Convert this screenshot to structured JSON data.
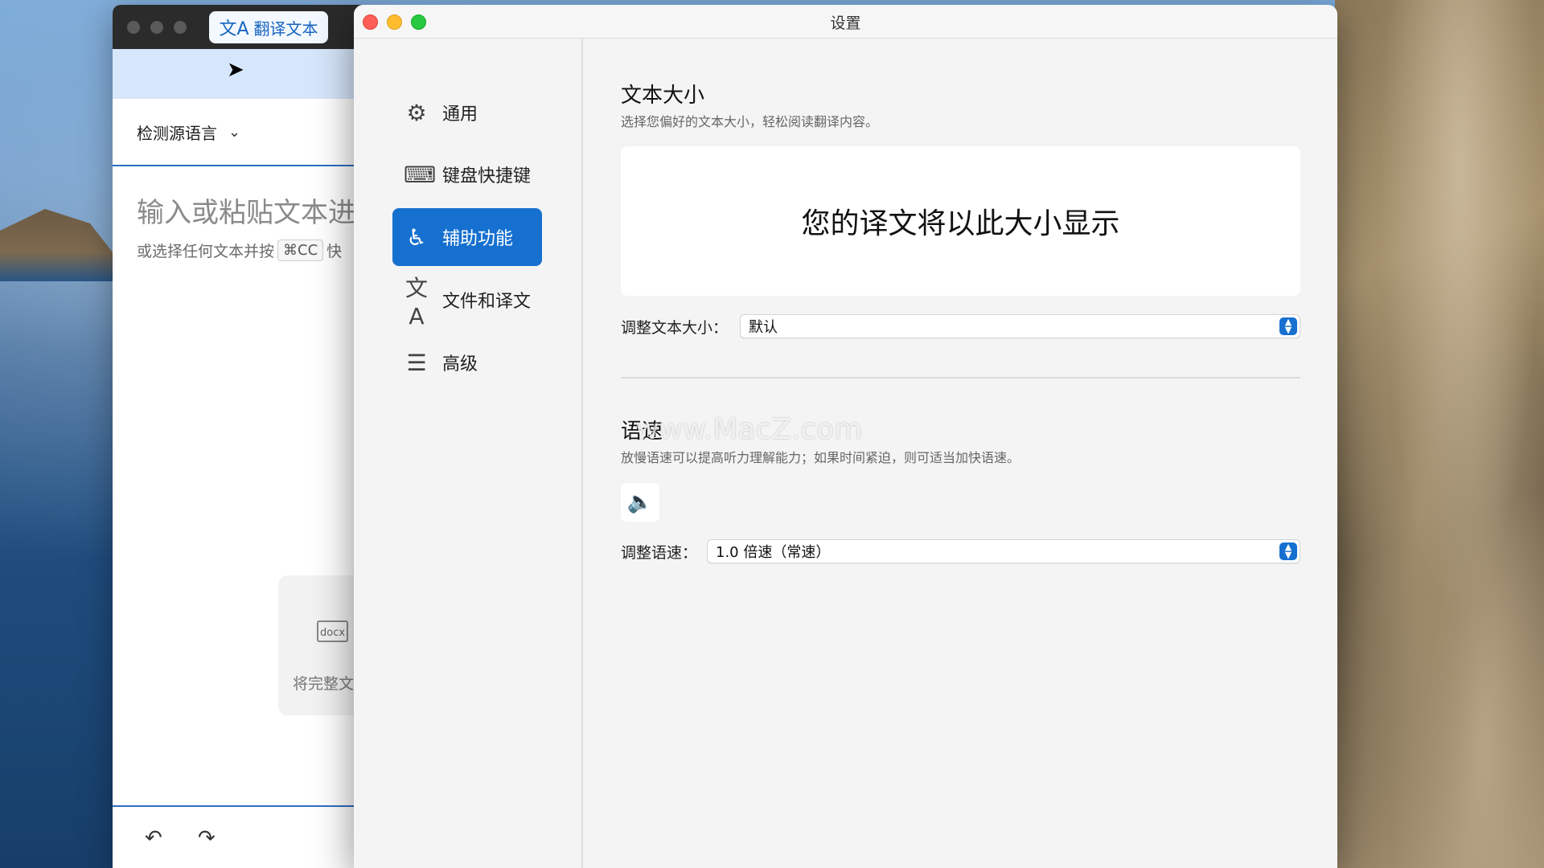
{
  "background_window": {
    "tab_label": "翻译文本",
    "source_language": "检测源语言",
    "input_placeholder": "输入或粘贴文本进",
    "hint_prefix": "或选择任何文本并按",
    "hint_shortcut": "⌘CC",
    "hint_suffix": "快",
    "drop_file_label": "docx",
    "drop_text": "将完整文"
  },
  "settings": {
    "window_title": "设置",
    "sidebar": [
      {
        "label": "通用",
        "icon": "gear-icon"
      },
      {
        "label": "键盘快捷键",
        "icon": "keyboard-icon"
      },
      {
        "label": "辅助功能",
        "icon": "accessibility-icon",
        "active": true
      },
      {
        "label": "文件和译文",
        "icon": "translate-icon"
      },
      {
        "label": "高级",
        "icon": "sliders-icon"
      }
    ],
    "text_size": {
      "title": "文本大小",
      "description": "选择您偏好的文本大小，轻松阅读翻译内容。",
      "preview": "您的译文将以此大小显示",
      "adjust_label": "调整文本大小：",
      "adjust_value": "默认"
    },
    "speech_rate": {
      "title": "语速",
      "description": "放慢语速可以提高听力理解能力；如果时间紧迫，则可适当加快语速。",
      "adjust_label": "调整语速：",
      "adjust_value": "1.0 倍速（常速）"
    }
  },
  "watermark": "www.MacZ.com",
  "colors": {
    "accent": "#1670d0",
    "window_bg": "#f4f4f4"
  }
}
